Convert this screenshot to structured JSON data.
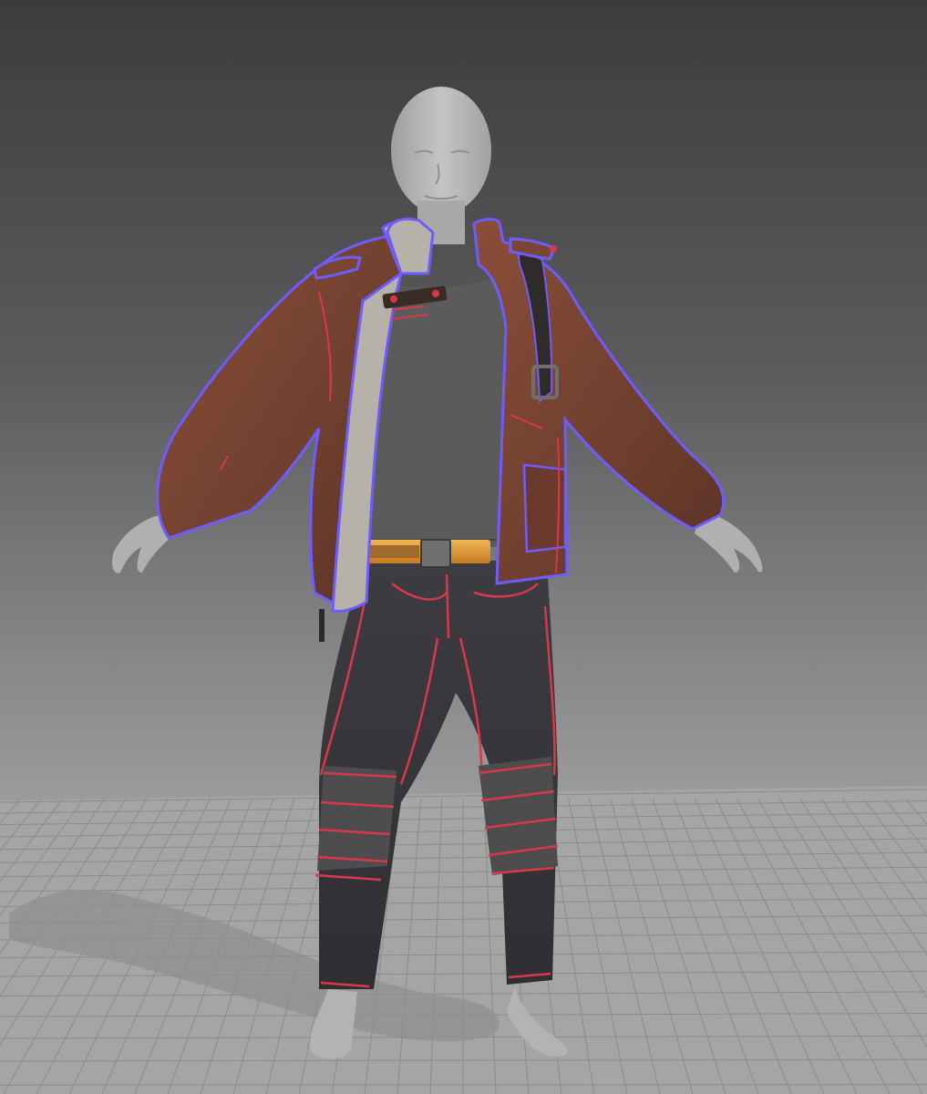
{
  "viewport": {
    "mode": "3d-garment-simulation-view",
    "background_top": "#3c3c3e",
    "background_bottom": "#a8a8a8"
  },
  "floor": {
    "visible": true,
    "grid": true,
    "color": "#a4a4a4",
    "grid_color": "#8b8b8b"
  },
  "avatar": {
    "skin_color": "#b9b9b9",
    "pose": "A-pose"
  },
  "garments": {
    "jacket": {
      "color": "#7a4634",
      "lining_color": "#b9b4ac",
      "selected": true,
      "outline_color": "#6f5cff"
    },
    "shirt": {
      "color": "#585858"
    },
    "belt": {
      "color": "#e79a3a"
    },
    "pants": {
      "color": "#3a3a3d"
    },
    "knee_wraps": {
      "color": "#4a4a4a"
    },
    "strap": {
      "color": "#2e2b28"
    }
  },
  "seam_color": "#d8394a"
}
